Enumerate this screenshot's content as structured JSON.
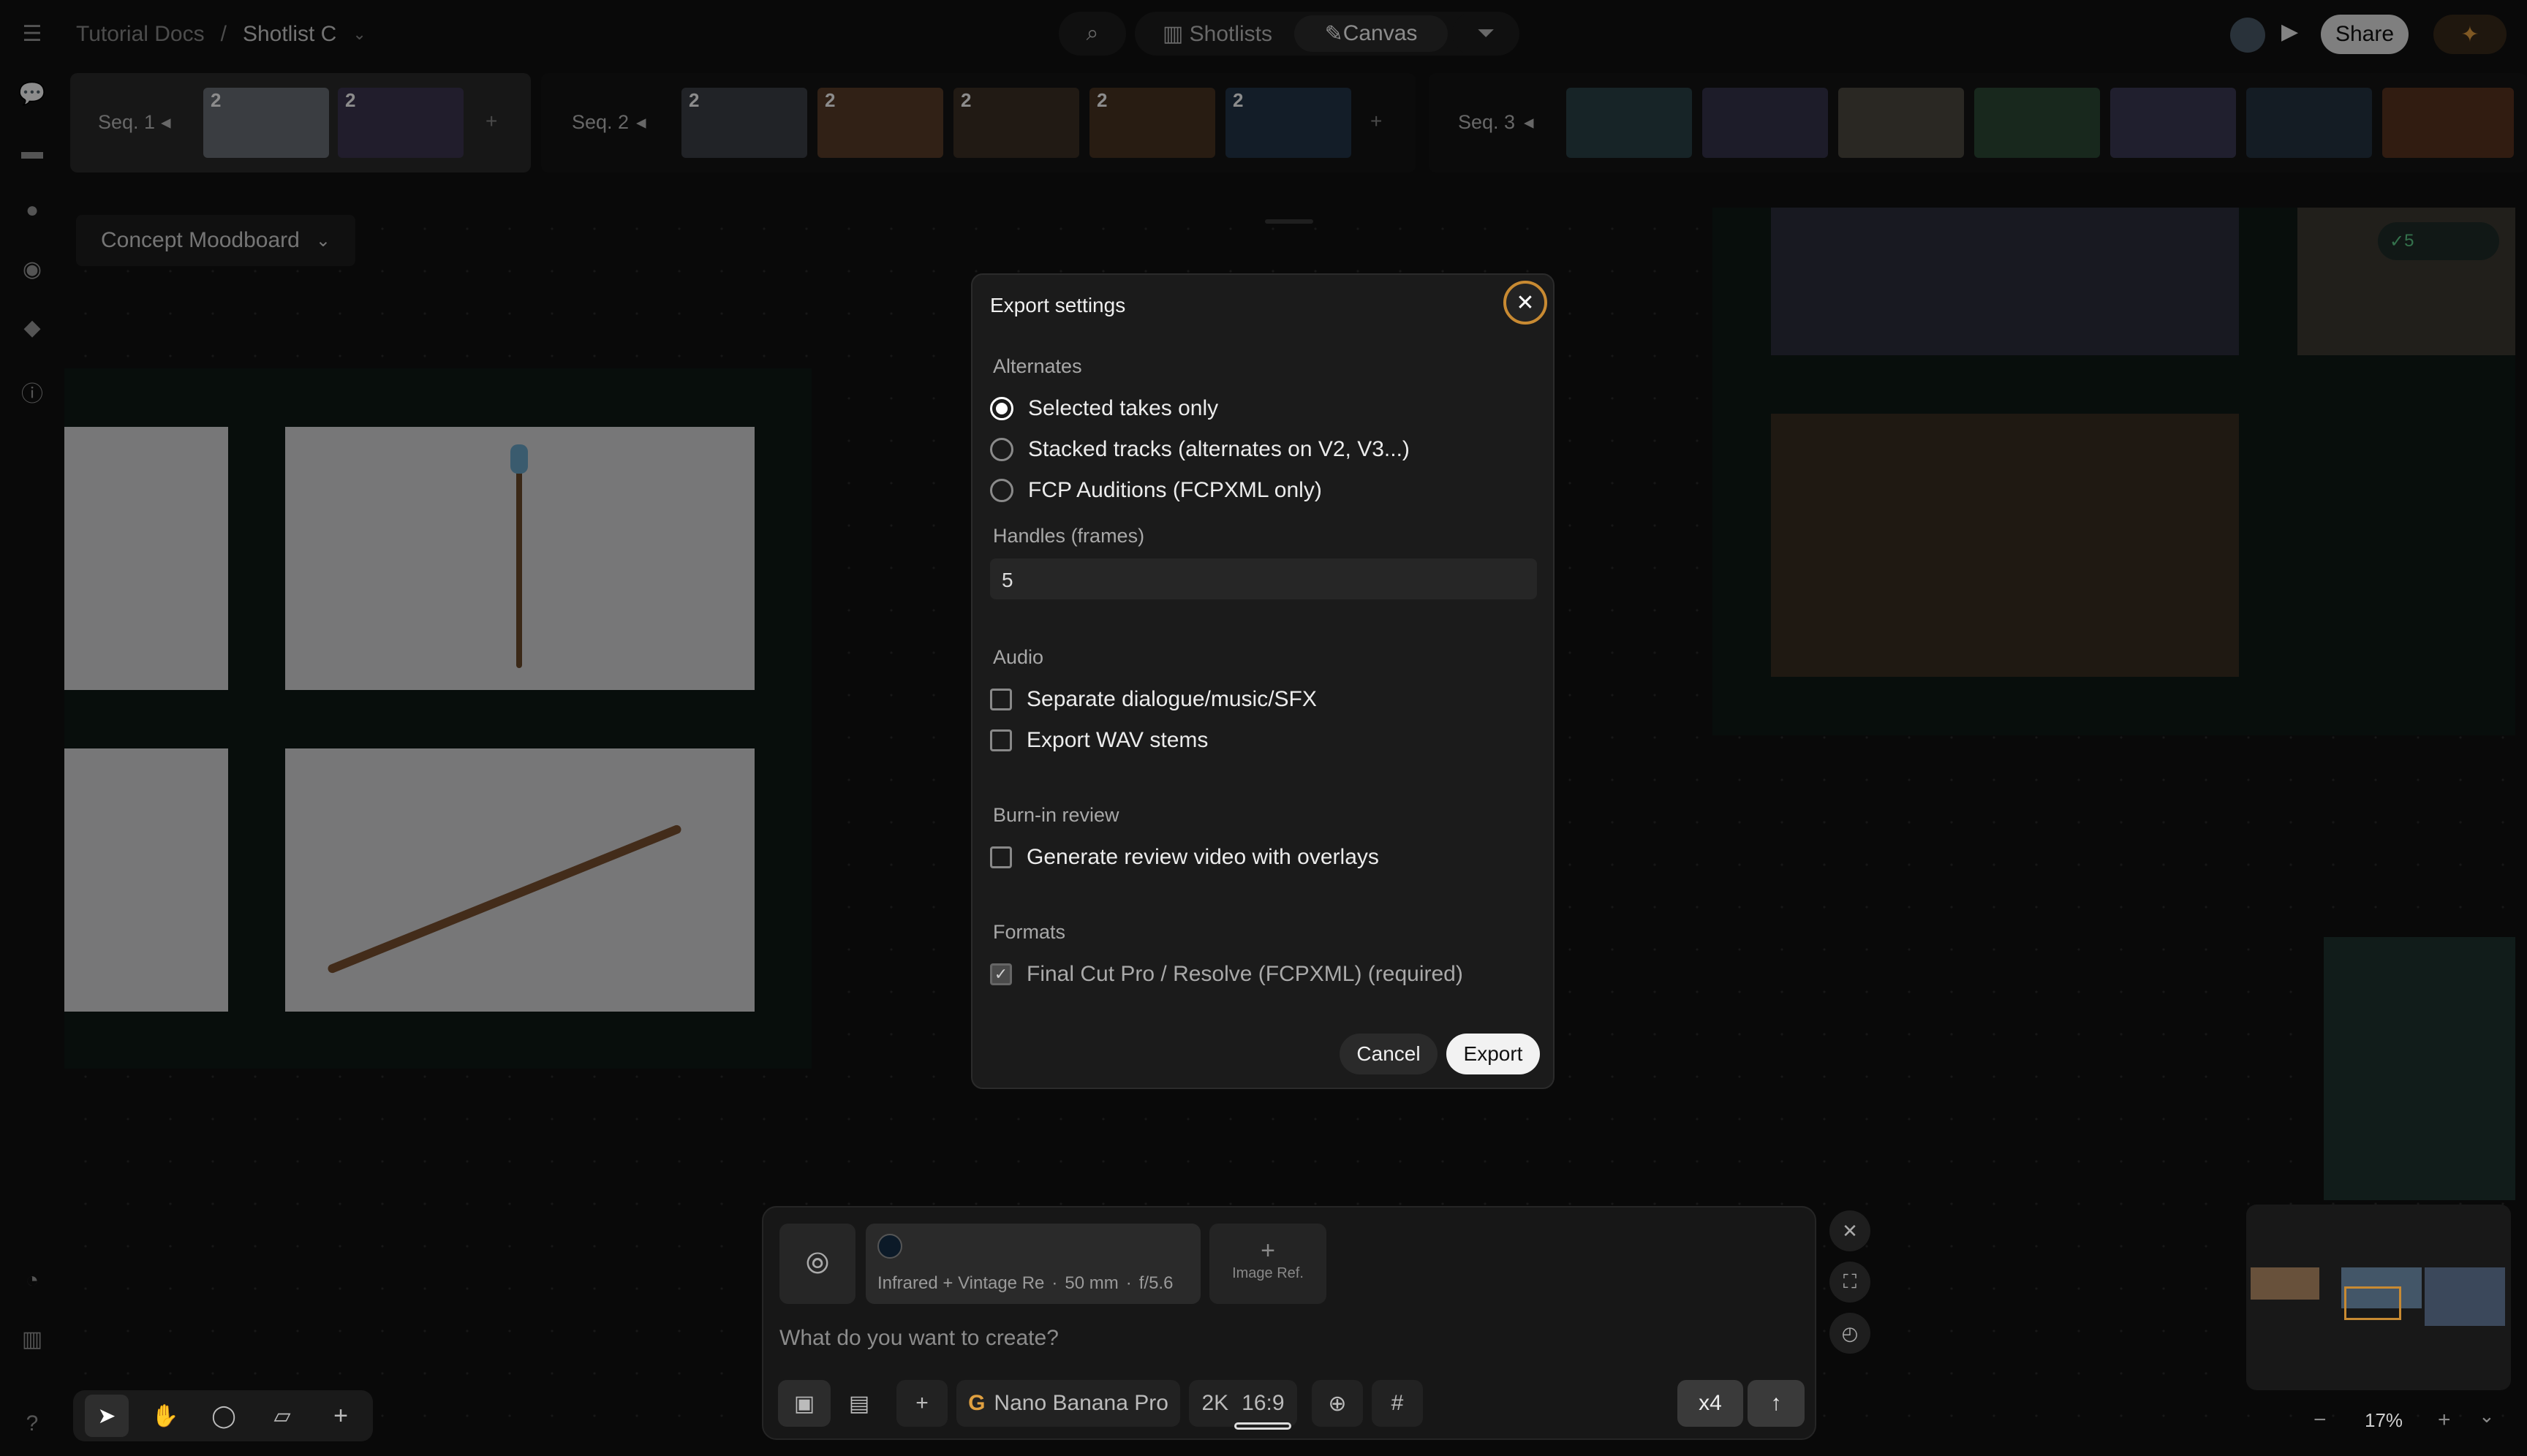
{
  "breadcrumb": {
    "root": "Tutorial Docs",
    "sep": "/",
    "current": "Shotlist C"
  },
  "header": {
    "tab_shotlists": "Shotlists",
    "tab_canvas": "Canvas",
    "share": "Share"
  },
  "sidebar": {
    "icons": [
      "menu-icon",
      "chat-icon",
      "folder-icon",
      "user-icon",
      "location-icon",
      "cube-icon",
      "info-icon"
    ],
    "bottom": [
      "history-icon",
      "analytics-icon",
      "help-icon"
    ]
  },
  "sequences": [
    {
      "label": "Seq. 1",
      "thumbs": [
        "2",
        "2"
      ]
    },
    {
      "label": "Seq. 2",
      "thumbs": [
        "2",
        "2",
        "2",
        "2",
        "2"
      ]
    },
    {
      "label": "Seq. 3",
      "thumbs": [
        "",
        "",
        "",
        "",
        "",
        "",
        "",
        ""
      ]
    }
  ],
  "canvas": {
    "board_select": "Concept Moodboard",
    "badge_count": "5"
  },
  "modal": {
    "title": "Export settings",
    "alternates_label": "Alternates",
    "alternates": [
      {
        "label": "Selected takes only",
        "selected": true
      },
      {
        "label": "Stacked tracks (alternates on V2, V3...)",
        "selected": false
      },
      {
        "label": "FCP Auditions (FCPXML only)",
        "selected": false
      }
    ],
    "handles_label": "Handles (frames)",
    "handles_value": "5",
    "audio_label": "Audio",
    "audio": [
      {
        "label": "Separate dialogue/music/SFX",
        "checked": false
      },
      {
        "label": "Export WAV stems",
        "checked": false
      }
    ],
    "burnin_label": "Burn-in review",
    "burnin": [
      {
        "label": "Generate review video with overlays",
        "checked": false
      }
    ],
    "formats_label": "Formats",
    "formats": [
      {
        "label": "Final Cut Pro / Resolve (FCPXML) (required)",
        "checked": true
      }
    ],
    "cancel": "Cancel",
    "export": "Export"
  },
  "prompt": {
    "style_name": "Infrared + Vintage Re",
    "lens": "50 mm",
    "aperture": "f/5.6",
    "image_ref": "Image Ref.",
    "placeholder": "What do you want to create?",
    "model": "Nano Banana Pro",
    "resolution": "2K",
    "aspect": "16:9",
    "count": "x4"
  },
  "zoom": {
    "value": "17%"
  },
  "colors": {
    "accent": "#c88a32",
    "background": "#121212",
    "board": "#0f1a17"
  }
}
